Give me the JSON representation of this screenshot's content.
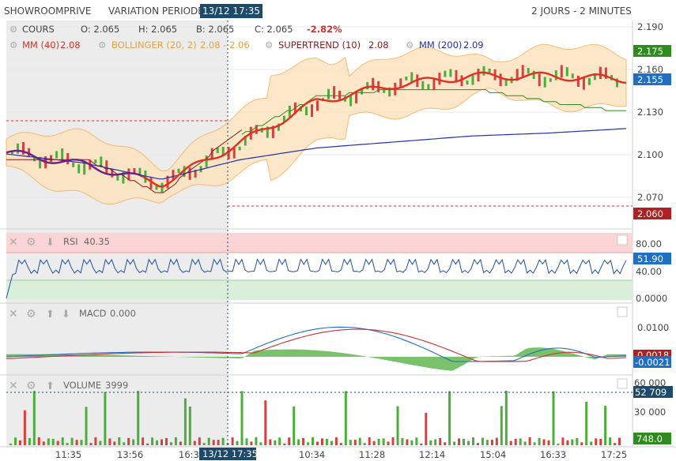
{
  "header": {
    "symbol": "SHOWROOMPRIVE",
    "variation_label": "VARIATION PERIODE",
    "cursor_time": "13/12 17:35",
    "period": "2 JOURS - 2 MINUTES"
  },
  "legend": {
    "cours_label": "COURS",
    "open": "O: 2.065",
    "high": "H: 2.065",
    "low": "B: 2.065",
    "close": "C: 2.065",
    "change": "-2.82%",
    "mm40": "MM (40)",
    "mm40_val": "2.08",
    "bollinger": "BOLLINGER (20, 2)",
    "bollinger_val": "2.08 - 2.06",
    "supertrend": "SUPERTREND (10)",
    "supertrend_val": "2.08",
    "mm200": "MM (200)",
    "mm200_val": "2.09"
  },
  "panels": {
    "rsi": {
      "label": "RSI",
      "value": "40.35",
      "ticks": [
        "80.00",
        "40.00",
        "0.0000"
      ],
      "badge": "51.90"
    },
    "macd": {
      "label": "MACD",
      "value": "0.000",
      "ticks": [
        "0.0100"
      ],
      "badge_red": "0.0018",
      "badge_blue": "-0.0021"
    },
    "volume": {
      "label": "VOLUME",
      "value": "3999",
      "ticks": [
        "60 000",
        "30 000"
      ],
      "badge_top": "52 709",
      "badge_bottom": "748.0"
    }
  },
  "price_axis": {
    "ticks": [
      "2.190",
      "2.160",
      "2.130",
      "2.100",
      "2.070"
    ],
    "badge_green": "2.175",
    "badge_blue": "2.155",
    "badge_red": "2.060"
  },
  "time_axis": {
    "labels": [
      "11:35",
      "13:56",
      "16:30",
      "10:34",
      "11:28",
      "12:14",
      "15:04",
      "16:33",
      "17:25"
    ],
    "cursor_label": "13/12 17:35"
  },
  "colors": {
    "up": "#4cae3a",
    "down": "#d84040",
    "mm40": "#e03020",
    "mm200": "#2030b0",
    "bollinger_fill": "#fde3c0",
    "bollinger_line": "#f5b060",
    "supertrend_up": "#2e8b1e",
    "supertrend_down": "#8b1a1a",
    "badge_blue": "#1f6fc4",
    "badge_dark": "#1d4a6b"
  },
  "chart_data": {
    "type": "line",
    "title": "SHOWROOMPRIVE",
    "x": [
      "11:35",
      "13:56",
      "16:30",
      "10:34",
      "11:28",
      "12:14",
      "15:04",
      "16:33",
      "17:25"
    ],
    "series": [
      {
        "name": "MM (40)",
        "values": [
          2.106,
          2.098,
          2.085,
          2.112,
          2.14,
          2.151,
          2.157,
          2.157,
          2.155
        ]
      },
      {
        "name": "MM (200)",
        "values": [
          2.105,
          2.099,
          2.088,
          2.101,
          2.109,
          2.113,
          2.117,
          2.119,
          2.122
        ]
      },
      {
        "name": "SUPERTREND (10)",
        "values": [
          2.098,
          2.099,
          2.075,
          2.117,
          2.143,
          2.148,
          2.149,
          2.14,
          2.133
        ]
      }
    ],
    "ylim": [
      2.057,
      2.19
    ],
    "reference_lines": [
      2.122,
      2.062
    ],
    "rsi": {
      "last": 40.35,
      "levels": [
        80,
        40,
        0
      ]
    },
    "macd": {
      "last": 0.0
    },
    "volume": {
      "last": 3999
    }
  }
}
